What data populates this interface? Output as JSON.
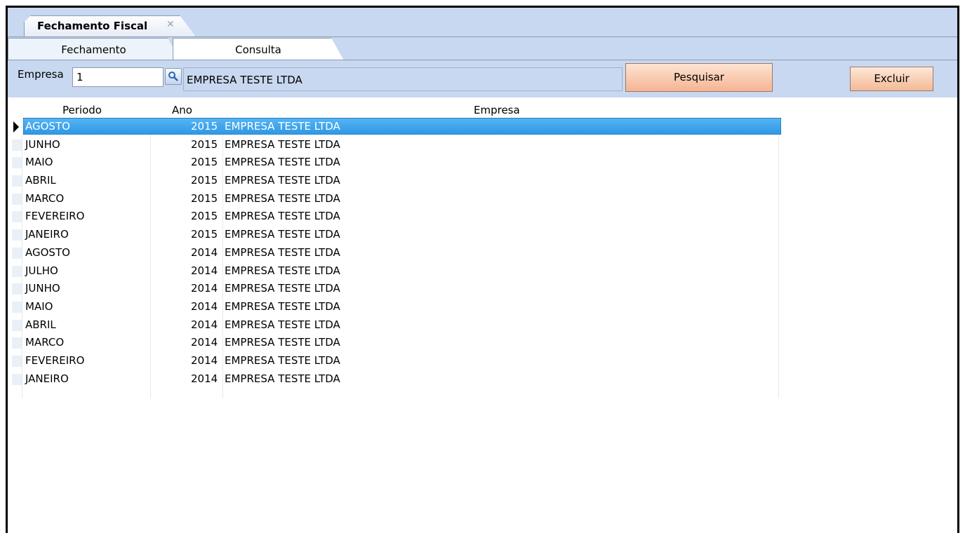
{
  "document_tab": {
    "title": "Fechamento Fiscal",
    "close_icon": "close-icon"
  },
  "tabs": [
    {
      "label": "Fechamento",
      "active": false
    },
    {
      "label": "Consulta",
      "active": true
    }
  ],
  "filter": {
    "empresa_label": "Empresa",
    "empresa_code": "1",
    "empresa_name": "EMPRESA TESTE LTDA",
    "search_icon": "magnifier-icon"
  },
  "buttons": {
    "pesquisar": "Pesquisar",
    "excluir": "Excluir"
  },
  "grid": {
    "columns": [
      "Periodo",
      "Ano",
      "Empresa"
    ],
    "rows": [
      {
        "periodo": "AGOSTO",
        "ano": "2015",
        "empresa": "EMPRESA TESTE LTDA",
        "selected": true
      },
      {
        "periodo": "JUNHO",
        "ano": "2015",
        "empresa": "EMPRESA TESTE LTDA"
      },
      {
        "periodo": "MAIO",
        "ano": "2015",
        "empresa": "EMPRESA TESTE LTDA"
      },
      {
        "periodo": "ABRIL",
        "ano": "2015",
        "empresa": "EMPRESA TESTE LTDA"
      },
      {
        "periodo": "MARCO",
        "ano": "2015",
        "empresa": "EMPRESA TESTE LTDA"
      },
      {
        "periodo": "FEVEREIRO",
        "ano": "2015",
        "empresa": "EMPRESA TESTE LTDA"
      },
      {
        "periodo": "JANEIRO",
        "ano": "2015",
        "empresa": "EMPRESA TESTE LTDA"
      },
      {
        "periodo": "AGOSTO",
        "ano": "2014",
        "empresa": "EMPRESA TESTE LTDA"
      },
      {
        "periodo": "JULHO",
        "ano": "2014",
        "empresa": "EMPRESA TESTE LTDA"
      },
      {
        "periodo": "JUNHO",
        "ano": "2014",
        "empresa": "EMPRESA TESTE LTDA"
      },
      {
        "periodo": "MAIO",
        "ano": "2014",
        "empresa": "EMPRESA TESTE LTDA"
      },
      {
        "periodo": "ABRIL",
        "ano": "2014",
        "empresa": "EMPRESA TESTE LTDA"
      },
      {
        "periodo": "MARCO",
        "ano": "2014",
        "empresa": "EMPRESA TESTE LTDA"
      },
      {
        "periodo": "FEVEREIRO",
        "ano": "2014",
        "empresa": "EMPRESA TESTE LTDA"
      },
      {
        "periodo": "JANEIRO",
        "ano": "2014",
        "empresa": "EMPRESA TESTE LTDA"
      }
    ]
  },
  "colors": {
    "selection": "#3a9fe8",
    "header_bg": "#c8d8f0",
    "button": "#f7c0a2"
  }
}
